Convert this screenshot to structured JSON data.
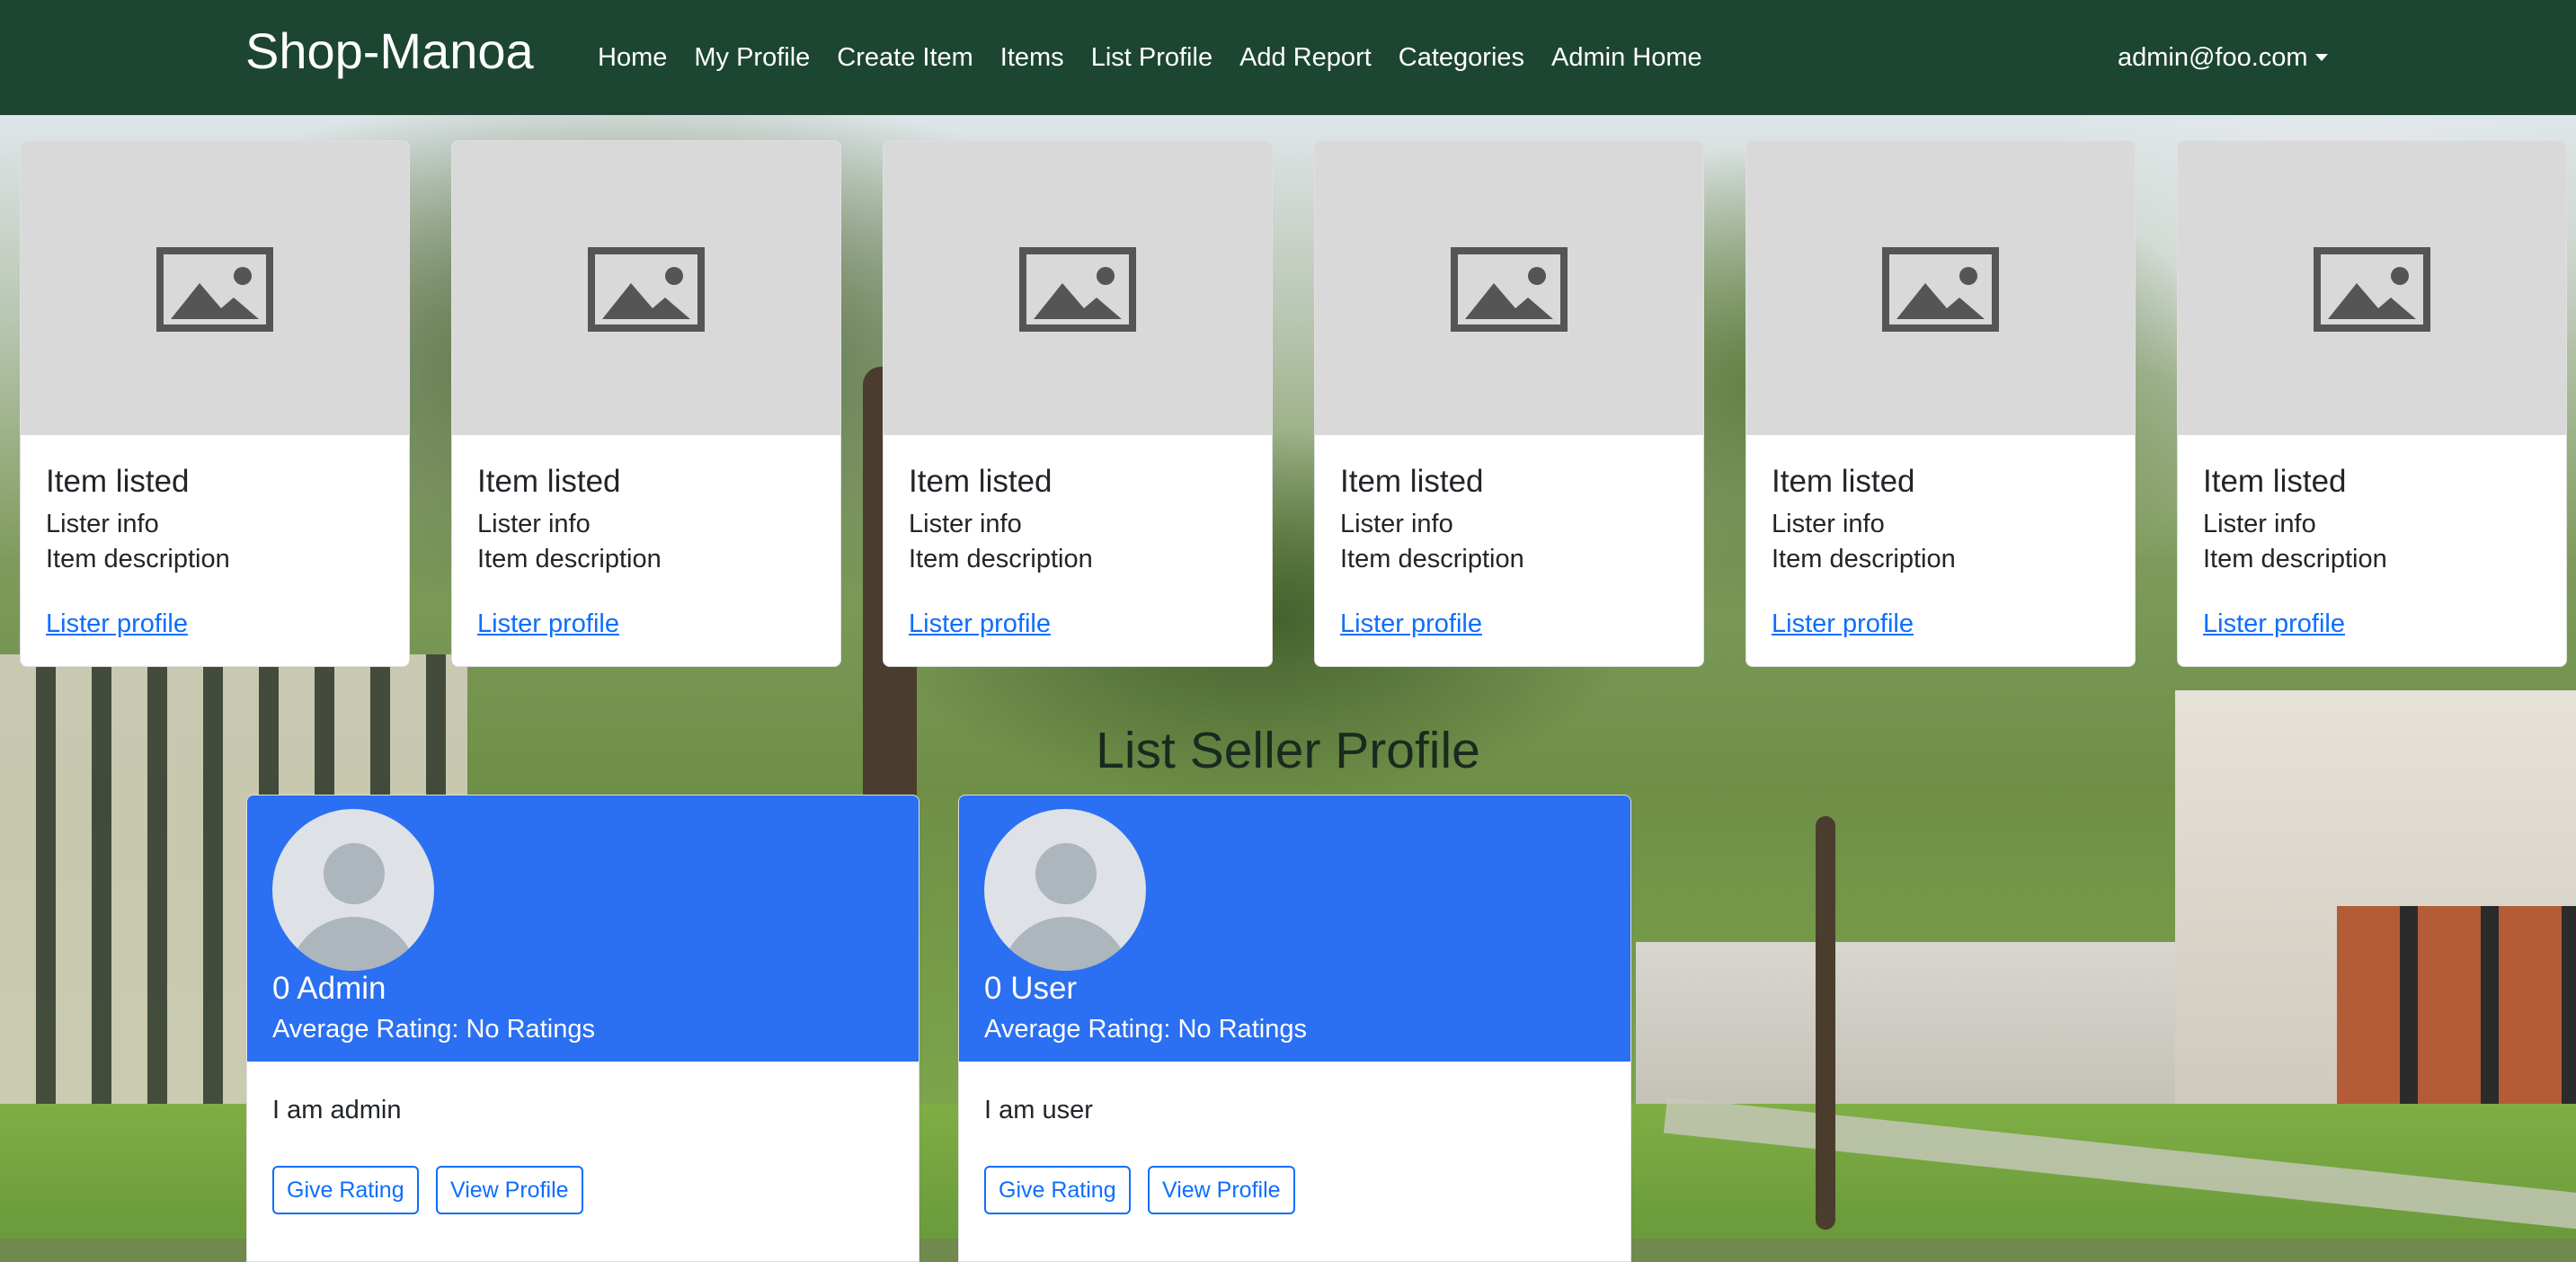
{
  "navbar": {
    "brand": "Shop-Manoa",
    "links": [
      "Home",
      "My Profile",
      "Create Item",
      "Items",
      "List Profile",
      "Add Report",
      "Categories",
      "Admin Home"
    ],
    "user": "admin@foo.com"
  },
  "items": [
    {
      "title": "Item listed",
      "lister": "Lister info",
      "description": "Item description",
      "link": "Lister profile",
      "image_icon": "image-placeholder-icon"
    },
    {
      "title": "Item listed",
      "lister": "Lister info",
      "description": "Item description",
      "link": "Lister profile",
      "image_icon": "image-placeholder-icon"
    },
    {
      "title": "Item listed",
      "lister": "Lister info",
      "description": "Item description",
      "link": "Lister profile",
      "image_icon": "image-placeholder-icon"
    },
    {
      "title": "Item listed",
      "lister": "Lister info",
      "description": "Item description",
      "link": "Lister profile",
      "image_icon": "image-placeholder-icon"
    },
    {
      "title": "Item listed",
      "lister": "Lister info",
      "description": "Item description",
      "link": "Lister profile",
      "image_icon": "image-placeholder-icon"
    },
    {
      "title": "Item listed",
      "lister": "Lister info",
      "description": "Item description",
      "link": "Lister profile",
      "image_icon": "image-placeholder-icon"
    }
  ],
  "seller_section": {
    "title": "List Seller Profile",
    "profiles": [
      {
        "name": "0 Admin",
        "rating": "Average Rating: No Ratings",
        "bio": "I am admin",
        "give_rating": "Give Rating",
        "view_profile": "View Profile"
      },
      {
        "name": "0 User",
        "rating": "Average Rating: No Ratings",
        "bio": "I am user",
        "give_rating": "Give Rating",
        "view_profile": "View Profile"
      }
    ]
  },
  "colors": {
    "navbar": "#1c4532",
    "profile_header": "#2b6ff2",
    "link": "#0d6efd",
    "placeholder": "#d9d9d9"
  }
}
